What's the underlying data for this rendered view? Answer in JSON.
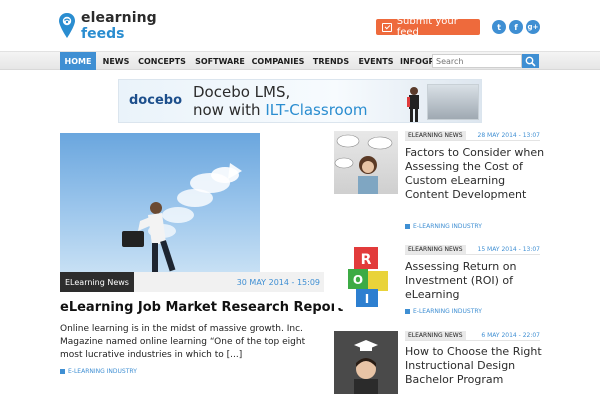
{
  "logo": {
    "line1": "elearning",
    "line2": "feeds"
  },
  "header": {
    "submit_label": "Submit your feed",
    "social": [
      {
        "icon": "twitter-icon",
        "glyph": "t"
      },
      {
        "icon": "facebook-icon",
        "glyph": "f"
      },
      {
        "icon": "google-plus-icon",
        "glyph": "g+"
      }
    ]
  },
  "nav": {
    "items": [
      "HOME",
      "NEWS",
      "CONCEPTS",
      "SOFTWARE",
      "COMPANIES",
      "TRENDS",
      "EVENTS",
      "INFOGR"
    ],
    "search_placeholder": "Search"
  },
  "banner": {
    "brand": "docebo",
    "line1": "Docebo LMS,",
    "line2_prefix": "now with ",
    "line2_highlight": "ILT-Classroom"
  },
  "featured": {
    "category": "ELearning News",
    "date": "30 MAY 2014 - 15:09",
    "title": "eLearning Job Market Research Report",
    "excerpt": "Online learning is in the midst of massive growth. Inc. Magazine named online learning “One of the top eight most lucrative industries in which to [...]",
    "tag": "E-LEARNING INDUSTRY"
  },
  "side_articles": [
    {
      "category": "ELEARNING NEWS",
      "date": "28 MAY 2014 - 13:07",
      "title": "Factors to Consider when Assessing the Cost of Custom eLearning Content Development",
      "tag": "E-LEARNING INDUSTRY"
    },
    {
      "category": "ELEARNING NEWS",
      "date": "15 MAY 2014 - 13:07",
      "title": "Assessing Return on Investment (ROI) of eLearning",
      "tag": "E-LEARNING INDUSTRY"
    },
    {
      "category": "ELEARNING NEWS",
      "date": "6 MAY 2014 - 22:07",
      "title": "How to Choose the Right Instructional Design Bachelor Program"
    }
  ],
  "colors": {
    "accent": "#3f8fd3",
    "submit": "#ee6a3c",
    "dark": "#2d2d2d"
  }
}
